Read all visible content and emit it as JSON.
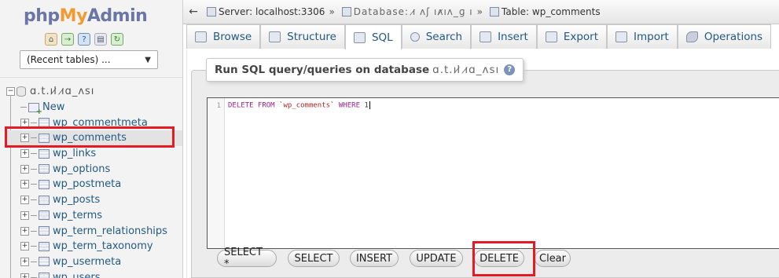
{
  "logo": {
    "php": "php",
    "my": "My",
    "admin": "Admin"
  },
  "sidebar": {
    "recent_tables": "(Recent tables) ...",
    "database_name": "ɑ.t.ıl̷ ı̷ɑ_ʌsı",
    "new_label": "New",
    "tables": [
      "wp_commentmeta",
      "wp_comments",
      "wp_links",
      "wp_options",
      "wp_postmeta",
      "wp_posts",
      "wp_terms",
      "wp_term_relationships",
      "wp_term_taxonomy",
      "wp_usermeta",
      "wp_users"
    ],
    "selected_table": "wp_comments"
  },
  "breadcrumb": {
    "server": "Server: localhost:3306",
    "database": "Database: ı̷ ʌʃ ıʌ̷ıʌ_ɡ ı",
    "table": "Table: wp_comments"
  },
  "tabs": [
    "Browse",
    "Structure",
    "SQL",
    "Search",
    "Insert",
    "Export",
    "Import",
    "Operations"
  ],
  "active_tab": "SQL",
  "sql_panel": {
    "legend": "Run SQL query/queries on database",
    "db": "ɑ.t.ıl̷ ı̷ɑ_ʌsı",
    "line_number": "1",
    "query_kw1": "DELETE FROM",
    "query_ident": "`wp_comments`",
    "query_kw2": "WHERE",
    "query_value": "1"
  },
  "buttons": [
    "SELECT *",
    "SELECT",
    "INSERT",
    "UPDATE",
    "DELETE",
    "Clear"
  ],
  "colors": {
    "highlight": "#e51b24",
    "link": "#235a81"
  }
}
